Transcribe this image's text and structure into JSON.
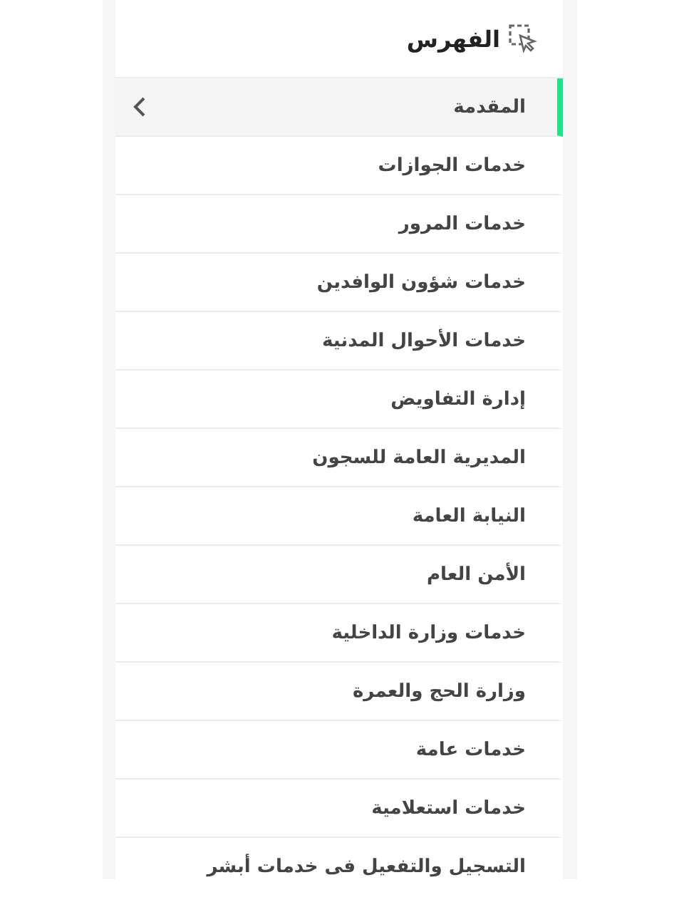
{
  "index": {
    "title": "الفهرس",
    "items": [
      {
        "label": "المقدمة",
        "selected": true
      },
      {
        "label": "خدمات الجوازات",
        "selected": false
      },
      {
        "label": "خدمات المرور",
        "selected": false
      },
      {
        "label": "خدمات شؤون الوافدين",
        "selected": false
      },
      {
        "label": "خدمات الأحوال المدنية",
        "selected": false
      },
      {
        "label": "إدارة التفاويض",
        "selected": false
      },
      {
        "label": "المديرية العامة للسجون",
        "selected": false
      },
      {
        "label": "النيابة العامة",
        "selected": false
      },
      {
        "label": "الأمن العام",
        "selected": false
      },
      {
        "label": "خدمات وزارة الداخلية",
        "selected": false
      },
      {
        "label": "وزارة الحج والعمرة",
        "selected": false
      },
      {
        "label": "خدمات عامة",
        "selected": false
      },
      {
        "label": "خدمات استعلامية",
        "selected": false
      },
      {
        "label": "التسجيل والتفعيل فى خدمات أبشر",
        "selected": false
      }
    ]
  }
}
